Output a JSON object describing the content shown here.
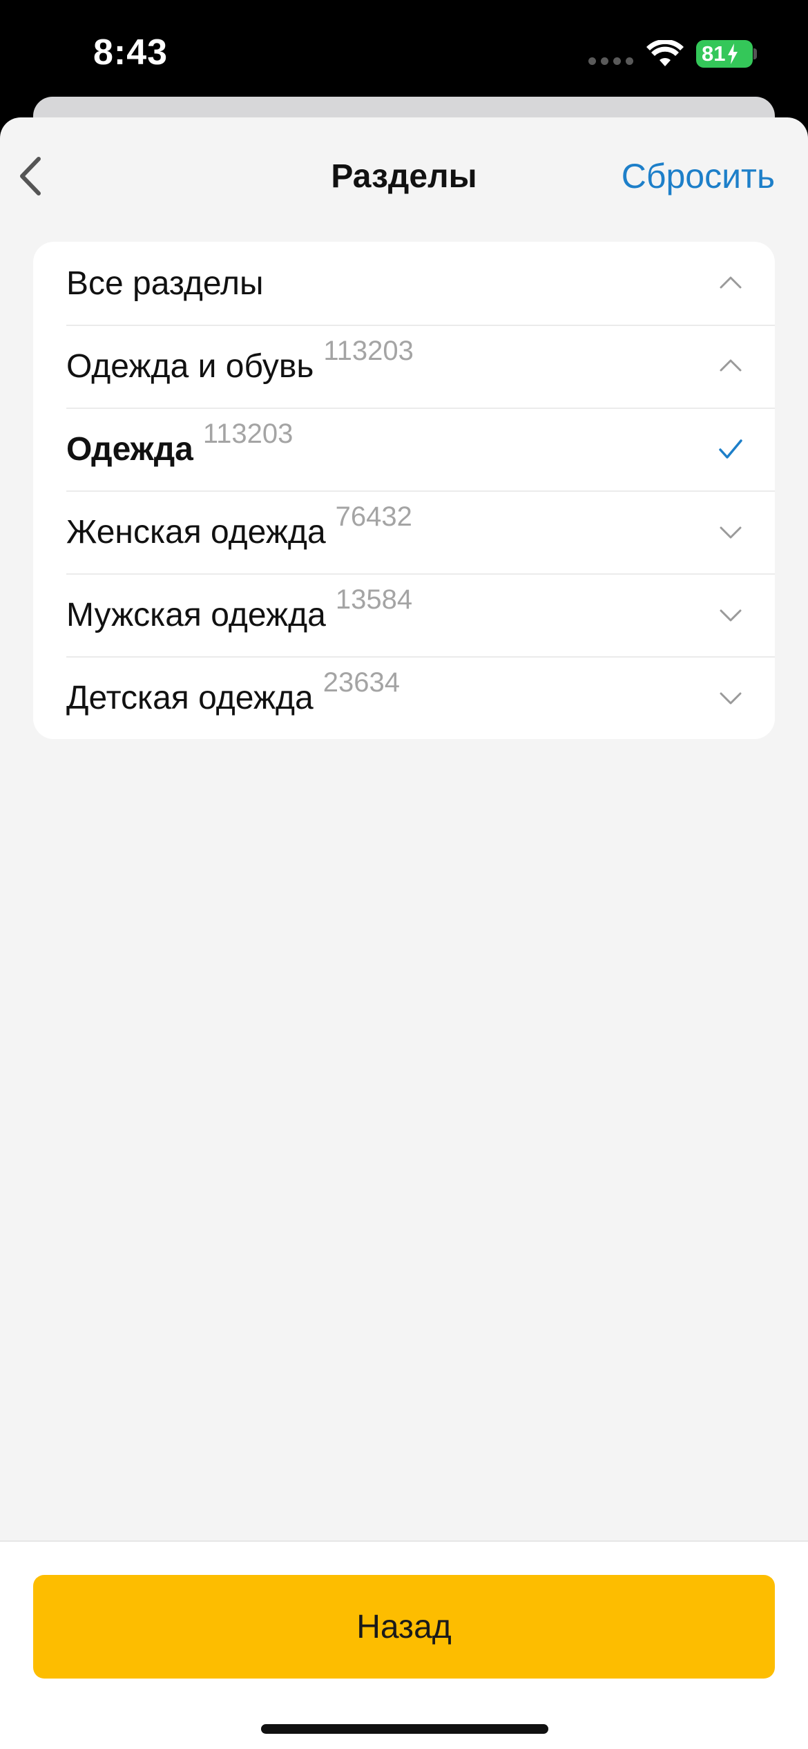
{
  "status_bar": {
    "time": "8:43",
    "battery": "81"
  },
  "nav": {
    "title": "Разделы",
    "reset_label": "Сбросить",
    "back_icon": "chevron-left-icon"
  },
  "sections": [
    {
      "label": "Все разделы",
      "count": "",
      "icon": "chevron-up-icon",
      "bold": false
    },
    {
      "label": "Одежда и обувь",
      "count": "113203",
      "icon": "chevron-up-icon",
      "bold": false
    },
    {
      "label": "Одежда",
      "count": "113203",
      "icon": "checkmark-icon",
      "bold": true
    },
    {
      "label": "Женская одежда",
      "count": "76432",
      "icon": "chevron-down-icon",
      "bold": false
    },
    {
      "label": "Мужская одежда",
      "count": "13584",
      "icon": "chevron-down-icon",
      "bold": false
    },
    {
      "label": "Детская одежда",
      "count": "23634",
      "icon": "chevron-down-icon",
      "bold": false
    }
  ],
  "footer": {
    "back_button_label": "Назад"
  },
  "colors": {
    "accent_link": "#1d7fc9",
    "primary_button": "#fdbd00",
    "battery": "#34c759"
  }
}
